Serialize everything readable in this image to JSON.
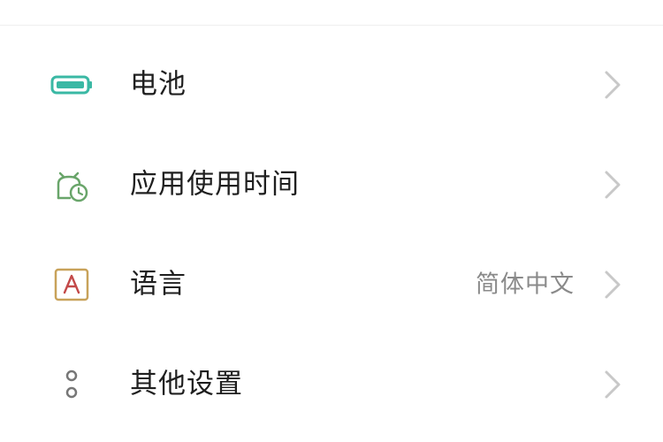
{
  "settings": {
    "items": [
      {
        "label": "电池",
        "value": "",
        "icon": "battery-icon",
        "icon_color": "#3ab8a4"
      },
      {
        "label": "应用使用时间",
        "value": "",
        "icon": "app-usage-time-icon",
        "icon_color": "#69a56a"
      },
      {
        "label": "语言",
        "value": "简体中文",
        "icon": "language-icon",
        "icon_color": "#c8a25a"
      },
      {
        "label": "其他设置",
        "value": "",
        "icon": "other-settings-icon",
        "icon_color": "#777777"
      }
    ]
  },
  "colors": {
    "chevron": "#c8c8c8",
    "label": "#1f1f1f",
    "value": "#8a8a8a",
    "language_letter": "#c34949"
  }
}
